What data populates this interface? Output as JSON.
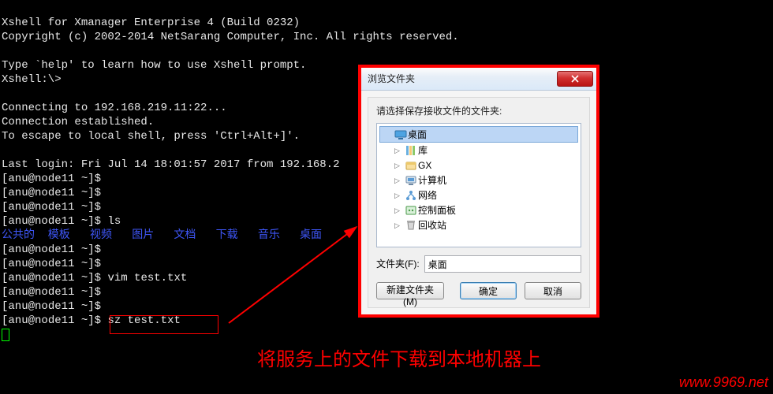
{
  "terminal": {
    "line1": "Xshell for Xmanager Enterprise 4 (Build 0232)",
    "line2": "Copyright (c) 2002-2014 NetSarang Computer, Inc. All rights reserved.",
    "blank1": "",
    "line3": "Type `help' to learn how to use Xshell prompt.",
    "line4": "Xshell:\\>",
    "blank2": "",
    "line5": "Connecting to 192.168.219.11:22...",
    "line6": "Connection established.",
    "line7": "To escape to local shell, press 'Ctrl+Alt+]'.",
    "blank3": "",
    "line8": "Last login: Fri Jul 14 18:01:57 2017 from 192.168.2",
    "prompt_user": "anu@node11 ~",
    "cmd_ls": "ls",
    "blue_line": "公共的  模板   视频   图片   文档   下载   音乐   桌面",
    "cmd_vim": "vim test.txt",
    "cmd_sz": "sz test.txt"
  },
  "dialog": {
    "title": "浏览文件夹",
    "prompt": "请选择保存接收文件的文件夹:",
    "tree": [
      {
        "label": "桌面",
        "icon": "desktop",
        "selected": true,
        "child": false,
        "expander": ""
      },
      {
        "label": "库",
        "icon": "library",
        "selected": false,
        "child": true,
        "expander": "▷"
      },
      {
        "label": "GX",
        "icon": "user",
        "selected": false,
        "child": true,
        "expander": "▷"
      },
      {
        "label": "计算机",
        "icon": "computer",
        "selected": false,
        "child": true,
        "expander": "▷"
      },
      {
        "label": "网络",
        "icon": "network",
        "selected": false,
        "child": true,
        "expander": "▷"
      },
      {
        "label": "控制面板",
        "icon": "cpanel",
        "selected": false,
        "child": true,
        "expander": "▷"
      },
      {
        "label": "回收站",
        "icon": "bin",
        "selected": false,
        "child": true,
        "expander": "▷"
      }
    ],
    "folder_label": "文件夹(F):",
    "folder_value": "桌面",
    "btn_new": "新建文件夹(M)",
    "btn_ok": "确定",
    "btn_cancel": "取消"
  },
  "annotation": {
    "caption": "将服务上的文件下载到本地机器上",
    "watermark": "www.9969.net"
  }
}
